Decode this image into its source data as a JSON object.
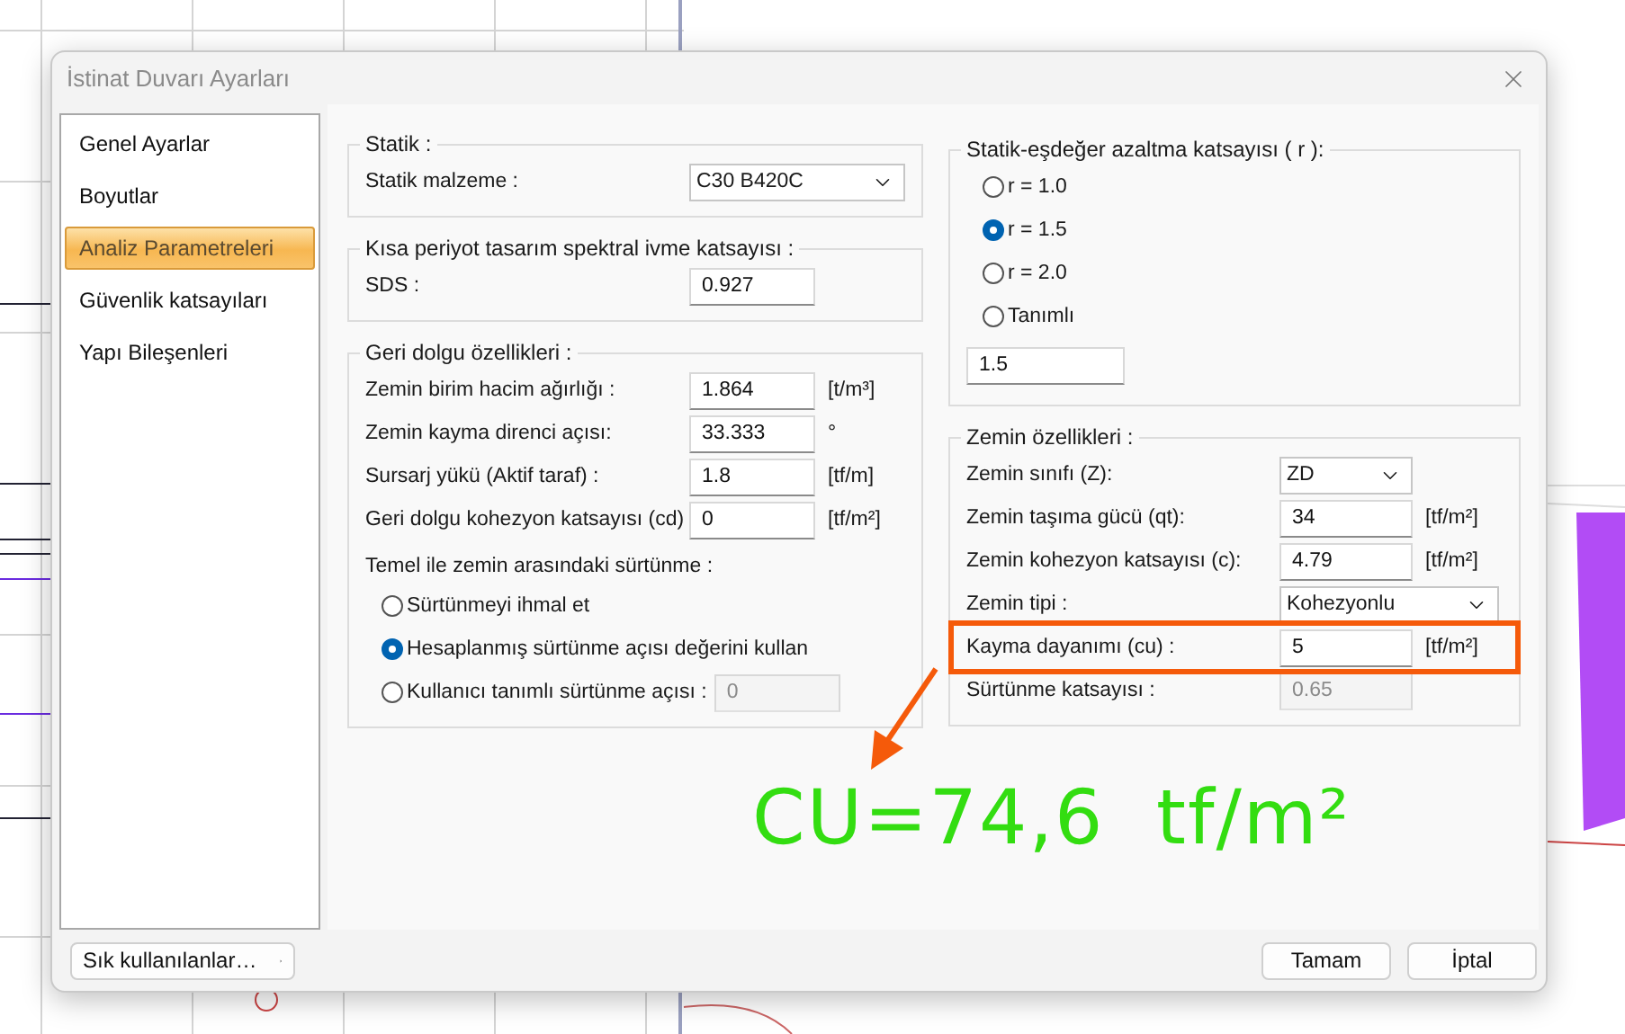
{
  "window": {
    "title": "İstinat Duvarı Ayarları"
  },
  "sidebar": {
    "items": [
      {
        "label": "Genel Ayarlar",
        "selected": false
      },
      {
        "label": "Boyutlar",
        "selected": false
      },
      {
        "label": "Analiz Parametreleri",
        "selected": true
      },
      {
        "label": "Güvenlik katsayıları",
        "selected": false
      },
      {
        "label": "Yapı Bileşenleri",
        "selected": false
      }
    ]
  },
  "left_groups": [
    {
      "title": "Statik :",
      "rows": [
        {
          "kind": "wide_combo",
          "label": "Statik malzeme :",
          "value": "C30 B420C"
        }
      ]
    },
    {
      "title": "Kısa periyot tasarım spektral ivme katsayısı :",
      "rows": [
        {
          "kind": "input",
          "label": "SDS :",
          "value": "0.927",
          "disabled": false
        }
      ]
    },
    {
      "title": "Geri dolgu özellikleri :",
      "rows": [
        {
          "kind": "input",
          "label": "Zemin birim hacim ağırlığı :",
          "value": "1.864",
          "unit": "[t/m³]",
          "disabled": false
        },
        {
          "kind": "input",
          "label": "Zemin kayma direnci açısı:",
          "value": "33.333",
          "unit": "°",
          "disabled": false
        },
        {
          "kind": "input",
          "label": "Sursarj yükü (Aktif taraf) :",
          "value": "1.8",
          "unit": "[tf/m]",
          "disabled": false
        },
        {
          "kind": "input",
          "label": "Geri dolgu kohezyon katsayısı (cd)",
          "value": "0",
          "unit": "[tf/m²]",
          "disabled": false
        },
        {
          "kind": "heading",
          "label": "Temel ile zemin arasındaki sürtünme :"
        },
        {
          "kind": "radio",
          "label": "Sürtünmeyi ihmal et",
          "selected": false
        },
        {
          "kind": "radio",
          "label": "Hesaplanmış sürtünme açısı değerini kullan",
          "selected": true
        },
        {
          "kind": "radio_input",
          "label": "Kullanıcı tanımlı sürtünme açısı :",
          "selected": false,
          "value": "0",
          "disabled": true
        }
      ]
    }
  ],
  "right_groups": [
    {
      "title": "Statik-eşdeğer azaltma katsayısı ( r ):",
      "rows": [
        {
          "kind": "radio",
          "label": "r = 1.0",
          "selected": false
        },
        {
          "kind": "radio",
          "label": "r = 1.5",
          "selected": true
        },
        {
          "kind": "radio",
          "label": "r = 2.0",
          "selected": false
        },
        {
          "kind": "radio",
          "label": "Tanımlı",
          "selected": false
        },
        {
          "kind": "field",
          "value": "1.5",
          "disabled": false
        }
      ]
    },
    {
      "title": "Zemin özellikleri :",
      "rows": [
        {
          "kind": "combo",
          "label": "Zemin sınıfı (Z):",
          "value": "ZD",
          "highlighted": false
        },
        {
          "kind": "input",
          "label": "Zemin taşıma gücü (qt):",
          "value": "34",
          "unit": "[tf/m²]",
          "disabled": false,
          "highlighted": false
        },
        {
          "kind": "input",
          "label": "Zemin kohezyon katsayısı (c):",
          "value": "4.79",
          "unit": "[tf/m²]",
          "disabled": false,
          "highlighted": false
        },
        {
          "kind": "wide_combo",
          "label": "Zemin tipi :",
          "value": "Kohezyonlu",
          "highlighted": false
        },
        {
          "kind": "input",
          "label": "Kayma dayanımı (cu) :",
          "value": "5",
          "unit": "[tf/m²]",
          "disabled": false,
          "highlighted": true
        },
        {
          "kind": "input",
          "label": "Sürtünme katsayısı :",
          "value": "0.65",
          "disabled": true,
          "highlighted": false
        }
      ]
    }
  ],
  "footer": {
    "menu_button": "Sık kullanılanlar…",
    "buttons": [
      "Tamam",
      "İptal"
    ]
  },
  "annotation": {
    "text": "CU=74,6  tf/m²"
  }
}
